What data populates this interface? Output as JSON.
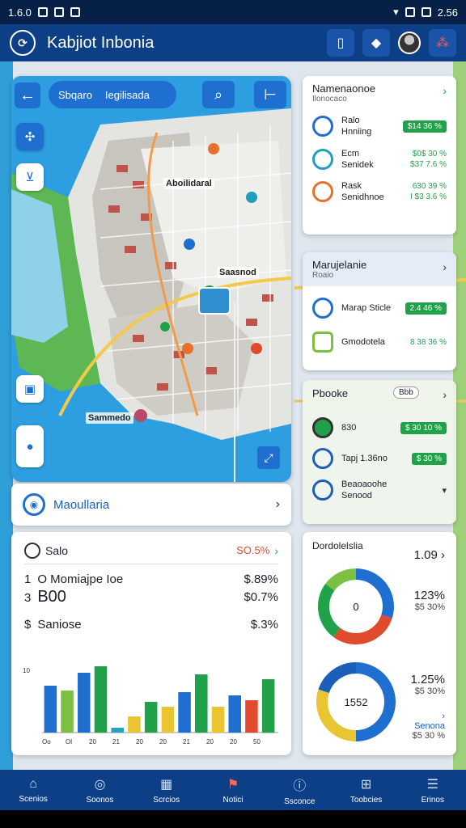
{
  "status_bar": {
    "time_left": "1.6.0",
    "time_right": "2.56"
  },
  "app": {
    "title": "Kabjiot Inbonia"
  },
  "map": {
    "search_primary": "Sbqaro",
    "search_secondary": "Iegilisada",
    "labels": [
      "Aboilidaral",
      "Saasnod",
      "Sammedo"
    ]
  },
  "location": {
    "label": "Maoullaria"
  },
  "stats": {
    "header_label": "Salo",
    "header_value": "SO.5%",
    "rows": [
      {
        "prefix": "1",
        "label": "O Momiajpe Ioe",
        "value": "$.89%"
      },
      {
        "prefix": "3",
        "label": "B00",
        "value": "$0.7%"
      },
      {
        "prefix": "$",
        "label": "Saniose",
        "value": "$.3%"
      }
    ]
  },
  "chart_data": {
    "type": "bar",
    "categories": [
      "Oo",
      "Ol",
      "20",
      "",
      "21",
      "",
      "20",
      "",
      "20",
      "",
      "21",
      "",
      "20",
      "",
      "20",
      "50"
    ],
    "series": [
      {
        "color": "#1f6fd1",
        "values": [
          58,
          54,
          74,
          78,
          6,
          38,
          32,
          38,
          50,
          54,
          30,
          46,
          38
        ]
      },
      {
        "color": "#7bc043",
        "values": [
          52,
          40,
          62,
          82,
          20,
          56,
          40,
          46,
          72,
          60,
          40,
          66,
          44
        ]
      }
    ],
    "ylim": [
      0,
      80
    ],
    "ytick": "10",
    "bars": [
      {
        "v": 58,
        "c": "#1f6fd1"
      },
      {
        "v": 52,
        "c": "#7bc043"
      },
      {
        "v": 74,
        "c": "#1f6fd1"
      },
      {
        "v": 82,
        "c": "#21a24a"
      },
      {
        "v": 6,
        "c": "#2aa0c0"
      },
      {
        "v": 20,
        "c": "#e8c531"
      },
      {
        "v": 38,
        "c": "#21a24a"
      },
      {
        "v": 32,
        "c": "#e8c531"
      },
      {
        "v": 50,
        "c": "#1f6fd1"
      },
      {
        "v": 72,
        "c": "#21a24a"
      },
      {
        "v": 32,
        "c": "#e8c531"
      },
      {
        "v": 46,
        "c": "#1f6fd1"
      },
      {
        "v": 40,
        "c": "#e04b2e"
      },
      {
        "v": 66,
        "c": "#21a24a"
      }
    ]
  },
  "panel_nav": {
    "title": "Namenaonoe",
    "subtitle": "Ilonocaco",
    "items": [
      {
        "label1": "Ralo",
        "label2": "Hnniing",
        "value": "$14 36 %",
        "pill": true,
        "color": "#1f6fd1"
      },
      {
        "label1": "Ecm",
        "label2": "Senidek",
        "value": "$0$ 30 %",
        "value2": "$37 7.6 %",
        "pill": false,
        "color": "#1f6fd1"
      },
      {
        "label1": "Rask",
        "label2": "Senidhnoe",
        "value": "630 39 %",
        "value2": "I $3 3.6 %",
        "pill": false,
        "color": "#e04b2e"
      }
    ]
  },
  "panel_metrics": {
    "title": "Marujelanie",
    "subtitle": "Roaio",
    "items": [
      {
        "label": "Marap Sticle",
        "value": "2.4 46 %",
        "pill": true,
        "color": "#1f6fd1"
      },
      {
        "label": "Gmodotela",
        "value": "8 38 36 %",
        "pill": false,
        "color": "#7bc043"
      }
    ]
  },
  "panel_places": {
    "title": "Pbooke",
    "badge": "Bbb",
    "items": [
      {
        "label": "830",
        "value": "$ 30 10 %"
      },
      {
        "label": "Tapj 1.36no",
        "value": "$ 30 %"
      },
      {
        "label": "Beaoaoohe",
        "label2": "Senood"
      }
    ]
  },
  "donuts": {
    "title": "Dordolelslia",
    "top_value": "1.09",
    "donut1": {
      "center": "0",
      "pct": "123%",
      "sub": "$5 30%",
      "segments": [
        {
          "v": 30,
          "c": "#1f6fd1"
        },
        {
          "v": 30,
          "c": "#e04b2e"
        },
        {
          "v": 25,
          "c": "#21a24a"
        },
        {
          "v": 15,
          "c": "#7bc043"
        }
      ]
    },
    "donut2": {
      "center": "1552",
      "pct": "1.25%",
      "sub": "$5 30%",
      "segments": [
        {
          "v": 50,
          "c": "#1f6fd1"
        },
        {
          "v": 30,
          "c": "#e8c531"
        },
        {
          "v": 20,
          "c": "#1a5fb8"
        }
      ]
    },
    "footer_label": "Senona",
    "footer_value": "$5 30 %"
  },
  "bottom_nav": [
    {
      "label": "Scenios",
      "icon": "home-icon"
    },
    {
      "label": "Soonos",
      "icon": "compass-icon"
    },
    {
      "label": "Scrcios",
      "icon": "calendar-icon"
    },
    {
      "label": "Notici",
      "icon": "flag-icon"
    },
    {
      "label": "Ssconce",
      "icon": "info-icon"
    },
    {
      "label": "Toobcies",
      "icon": "grid-icon"
    },
    {
      "label": "Erinos",
      "icon": "menu-icon"
    }
  ]
}
